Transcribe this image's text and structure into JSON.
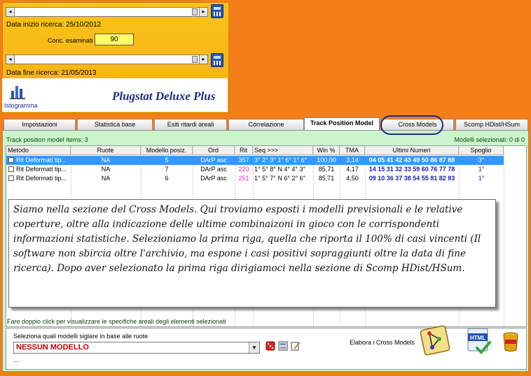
{
  "top_panel": {
    "start_label": "Data inizio ricerca:",
    "start_date": "25/10/2012",
    "conc_label": "Conc. esaminati",
    "conc_value": "90",
    "end_label": "Data fine ricerca:",
    "end_date": "21/05/2013",
    "app_name": "Plugstat Deluxe Plus",
    "istogramma_label": "Istogramma"
  },
  "tabs": [
    {
      "label": "Impostazioni"
    },
    {
      "label": "Statistica base"
    },
    {
      "label": "Esiti ritardi areali"
    },
    {
      "label": "Correlazione"
    },
    {
      "label": "Track Position Model"
    },
    {
      "label": "Cross Models"
    },
    {
      "label": "Scomp HDist/HSum"
    }
  ],
  "main": {
    "items_count": "Track position model items: 3",
    "models_selected": "Modelli selezionati: 0 di 0",
    "columns": [
      "Metodo",
      "Ruote",
      "Modello posiz.",
      "Ord",
      "Rit",
      "Seq >>>",
      "Win %",
      "TMA",
      "Ultimi Numeri",
      "Spoglio"
    ],
    "rows": [
      {
        "metodo": "Rit Deformati tip...",
        "ruote": "NA",
        "modello": "5",
        "ord": "DArP asc",
        "rit": "357",
        "seq": "3° 2° 3° 1° 6° 1° 6°",
        "win": "100,00",
        "tma": "3,14",
        "ultimi": "04 05 41 42 43 49 50 86 87 88",
        "spoglio": "3°"
      },
      {
        "metodo": "Rit Deformati tip...",
        "ruote": "NA",
        "modello": "7",
        "ord": "DArP asc",
        "rit": "220",
        "seq": "1° 5° 8° N 4° 4° 3°",
        "win": "85,71",
        "tma": "4,17",
        "ultimi": "14 15 31 32 33 59 60 76 77 78",
        "spoglio": "1°"
      },
      {
        "metodo": "Rit Deformati tip...",
        "ruote": "NA",
        "modello": "6",
        "ord": "DArP asc",
        "rit": "251",
        "seq": "1° 5° 7° N 6° 2° 6°",
        "win": "85,71",
        "tma": "4,50",
        "ultimi": "09 10 36 37 38 54 55 81 82 83",
        "spoglio": "1°"
      }
    ],
    "annotation": "Siamo nella sezione del Cross Models. Qui troviamo esposti i modelli previsionali e le relative coperture, oltre alla indicazione delle ultime combinaizoni in gioco con le corrispondenti informazioni statistiche. Selezioniamo la prima riga, quella che riporta il 100% di casi vincenti (Il software non sbircia oltre l'archivio, ma espone i casi positivi sopraggiunti oltre la data di fine ricerca). Dopo aver selezionato la prima riga dirigiamoci nella sezione di Scomp HDist/HSum.",
    "hint": "Fare doppio click per visualizzare le specifiche areali degli elementi selezionati",
    "select_label": "Seleziona quali modelli siglare in base alle ruote",
    "combo_value": "NESSUN MODELLO",
    "elabora_label": "Elabora i Cross Models",
    "ellipsis": "..."
  },
  "colors": {
    "background": "#f47e1a",
    "panel": "#f7b715",
    "main": "#ccf5cc",
    "selected_row": "#3399ff"
  }
}
